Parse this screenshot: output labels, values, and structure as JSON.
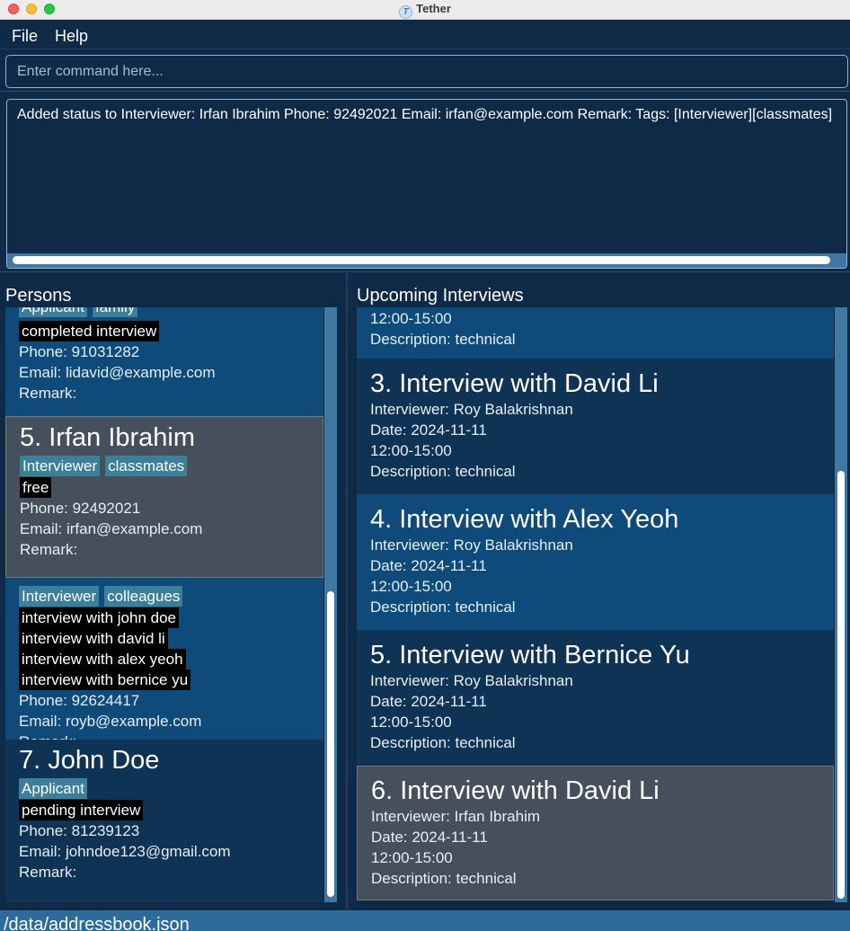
{
  "window": {
    "title": "Tether"
  },
  "menu": {
    "file": "File",
    "help": "Help"
  },
  "command": {
    "placeholder": "Enter command here...",
    "value": ""
  },
  "result": {
    "text": "Added status to Interviewer: Irfan Ibrahim Phone: 92492021 Email: irfan@example.com Remark:  Tags: [Interviewer][classmates]"
  },
  "persons": {
    "title": "Persons",
    "partial_top": {
      "tags": [
        "Applicant",
        "family"
      ],
      "status": "completed interview",
      "phone": "Phone: 91031282",
      "email": "Email: lidavid@example.com",
      "remark": "Remark:"
    },
    "selected": {
      "index": "5.",
      "name": "Irfan Ibrahim",
      "tags": [
        "Interviewer",
        "classmates"
      ],
      "status": "free",
      "phone": "Phone: 92492021",
      "email": "Email: irfan@example.com",
      "remark": "Remark:"
    },
    "roy": {
      "tags": [
        "Interviewer",
        "colleagues"
      ],
      "statuses": [
        "interview with john doe",
        "interview with david li",
        "interview with alex yeoh",
        "interview with bernice yu"
      ],
      "phone": "Phone: 92624417",
      "email": "Email: royb@example.com",
      "remark": "Remark:"
    },
    "john": {
      "index": "7.",
      "name": "John Doe",
      "tags": [
        "Applicant"
      ],
      "status": "pending interview",
      "phone": "Phone: 81239123",
      "email": "Email: johndoe123@gmail.com",
      "remark": "Remark:"
    }
  },
  "interviews": {
    "title": "Upcoming Interviews",
    "partial_top": {
      "time": "12:00-15:00",
      "description": "Description: technical"
    },
    "items": [
      {
        "index": "3.",
        "title": "Interview with David Li",
        "interviewer": "Interviewer: Roy Balakrishnan",
        "date": "Date: 2024-11-11",
        "time": "12:00-15:00",
        "description": "Description: technical"
      },
      {
        "index": "4.",
        "title": "Interview with Alex Yeoh",
        "interviewer": "Interviewer: Roy Balakrishnan",
        "date": "Date: 2024-11-11",
        "time": "12:00-15:00",
        "description": "Description: technical"
      },
      {
        "index": "5.",
        "title": "Interview with Bernice Yu",
        "interviewer": "Interviewer: Roy Balakrishnan",
        "date": "Date: 2024-11-11",
        "time": "12:00-15:00",
        "description": "Description: technical"
      },
      {
        "index": "6.",
        "title": "Interview with David Li",
        "interviewer": "Interviewer: Irfan Ibrahim",
        "date": "Date: 2024-11-11",
        "time": "12:00-15:00",
        "description": "Description: technical"
      }
    ]
  },
  "statusbar": {
    "path": "/data/addressbook.json"
  },
  "colors": {
    "background": "#0e2a46",
    "tag": "#3b7f99",
    "selected": "#46505c",
    "accent": "#3f79a3"
  }
}
